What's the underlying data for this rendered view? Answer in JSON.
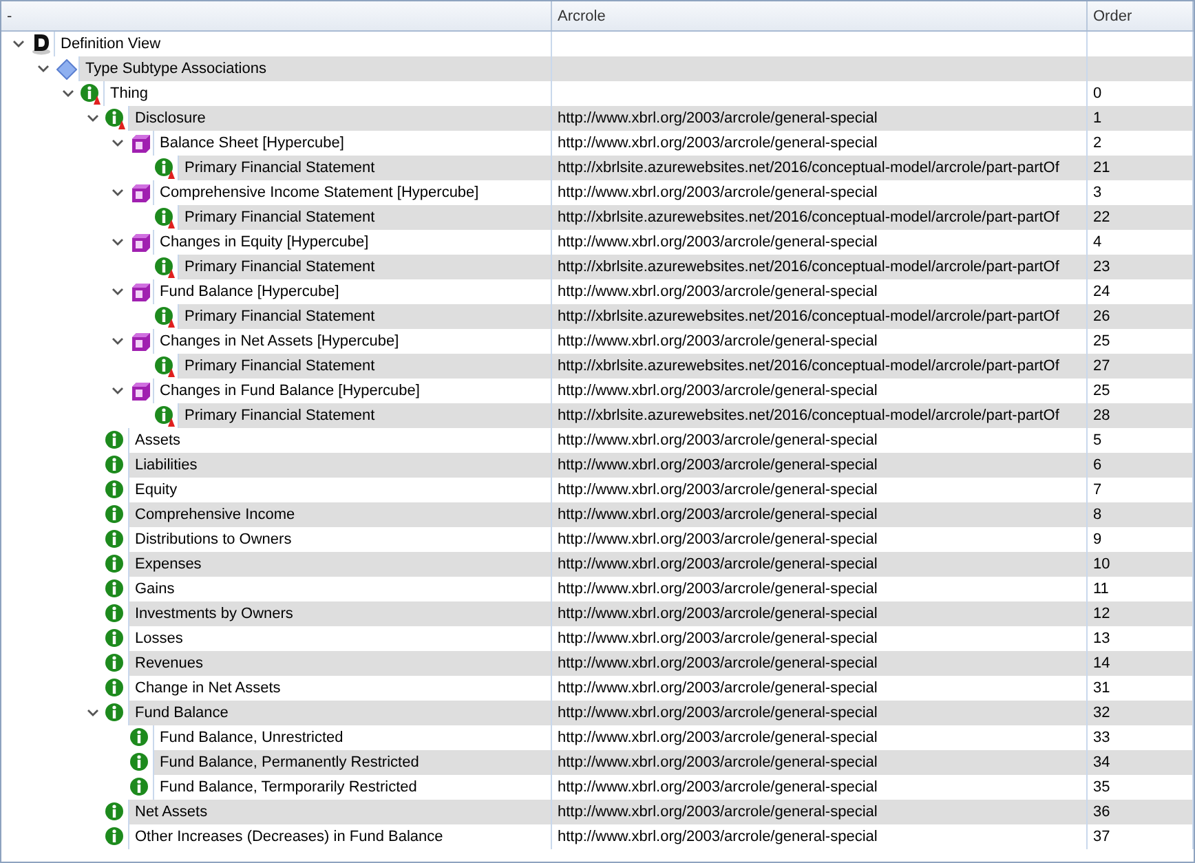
{
  "columns": [
    "-",
    "Arcrole",
    "Order"
  ],
  "tree": [
    {
      "kind": "definition",
      "label": "Definition View",
      "expanded": true,
      "children": [
        {
          "kind": "network",
          "label": "Type Subtype Associations",
          "expanded": true,
          "children": [
            {
              "kind": "abstract",
              "label": "Thing",
              "order": "0",
              "expanded": true,
              "children": [
                {
                  "kind": "abstract",
                  "label": "Disclosure",
                  "arcrole": "http://www.xbrl.org/2003/arcrole/general-special",
                  "order": "1",
                  "expanded": true,
                  "children": [
                    {
                      "kind": "hypercube",
                      "label": "Balance Sheet [Hypercube]",
                      "arcrole": "http://www.xbrl.org/2003/arcrole/general-special",
                      "order": "2",
                      "expanded": true,
                      "children": [
                        {
                          "kind": "abstract",
                          "label": "Primary Financial Statement",
                          "arcrole": "http://xbrlsite.azurewebsites.net/2016/conceptual-model/arcrole/part-partOf",
                          "order": "21"
                        }
                      ]
                    },
                    {
                      "kind": "hypercube",
                      "label": "Comprehensive Income Statement [Hypercube]",
                      "arcrole": "http://www.xbrl.org/2003/arcrole/general-special",
                      "order": "3",
                      "expanded": true,
                      "children": [
                        {
                          "kind": "abstract",
                          "label": "Primary Financial Statement",
                          "arcrole": "http://xbrlsite.azurewebsites.net/2016/conceptual-model/arcrole/part-partOf",
                          "order": "22"
                        }
                      ]
                    },
                    {
                      "kind": "hypercube",
                      "label": "Changes in Equity [Hypercube]",
                      "arcrole": "http://www.xbrl.org/2003/arcrole/general-special",
                      "order": "4",
                      "expanded": true,
                      "children": [
                        {
                          "kind": "abstract",
                          "label": "Primary Financial Statement",
                          "arcrole": "http://xbrlsite.azurewebsites.net/2016/conceptual-model/arcrole/part-partOf",
                          "order": "23"
                        }
                      ]
                    },
                    {
                      "kind": "hypercube",
                      "label": "Fund Balance [Hypercube]",
                      "arcrole": "http://www.xbrl.org/2003/arcrole/general-special",
                      "order": "24",
                      "expanded": true,
                      "children": [
                        {
                          "kind": "abstract",
                          "label": "Primary Financial Statement",
                          "arcrole": "http://xbrlsite.azurewebsites.net/2016/conceptual-model/arcrole/part-partOf",
                          "order": "26"
                        }
                      ]
                    },
                    {
                      "kind": "hypercube",
                      "label": "Changes in Net Assets [Hypercube]",
                      "arcrole": "http://www.xbrl.org/2003/arcrole/general-special",
                      "order": "25",
                      "expanded": true,
                      "children": [
                        {
                          "kind": "abstract",
                          "label": "Primary Financial Statement",
                          "arcrole": "http://xbrlsite.azurewebsites.net/2016/conceptual-model/arcrole/part-partOf",
                          "order": "27"
                        }
                      ]
                    },
                    {
                      "kind": "hypercube",
                      "label": "Changes in Fund Balance [Hypercube]",
                      "arcrole": "http://www.xbrl.org/2003/arcrole/general-special",
                      "order": "25",
                      "expanded": true,
                      "children": [
                        {
                          "kind": "abstract",
                          "label": "Primary Financial Statement",
                          "arcrole": "http://xbrlsite.azurewebsites.net/2016/conceptual-model/arcrole/part-partOf",
                          "order": "28"
                        }
                      ]
                    }
                  ]
                },
                {
                  "kind": "concept",
                  "label": "Assets",
                  "arcrole": "http://www.xbrl.org/2003/arcrole/general-special",
                  "order": "5"
                },
                {
                  "kind": "concept",
                  "label": "Liabilities",
                  "arcrole": "http://www.xbrl.org/2003/arcrole/general-special",
                  "order": "6"
                },
                {
                  "kind": "concept",
                  "label": "Equity",
                  "arcrole": "http://www.xbrl.org/2003/arcrole/general-special",
                  "order": "7"
                },
                {
                  "kind": "concept",
                  "label": "Comprehensive Income",
                  "arcrole": "http://www.xbrl.org/2003/arcrole/general-special",
                  "order": "8"
                },
                {
                  "kind": "concept",
                  "label": "Distributions to Owners",
                  "arcrole": "http://www.xbrl.org/2003/arcrole/general-special",
                  "order": "9"
                },
                {
                  "kind": "concept",
                  "label": "Expenses",
                  "arcrole": "http://www.xbrl.org/2003/arcrole/general-special",
                  "order": "10"
                },
                {
                  "kind": "concept",
                  "label": "Gains",
                  "arcrole": "http://www.xbrl.org/2003/arcrole/general-special",
                  "order": "11"
                },
                {
                  "kind": "concept",
                  "label": "Investments by Owners",
                  "arcrole": "http://www.xbrl.org/2003/arcrole/general-special",
                  "order": "12"
                },
                {
                  "kind": "concept",
                  "label": "Losses",
                  "arcrole": "http://www.xbrl.org/2003/arcrole/general-special",
                  "order": "13"
                },
                {
                  "kind": "concept",
                  "label": "Revenues",
                  "arcrole": "http://www.xbrl.org/2003/arcrole/general-special",
                  "order": "14"
                },
                {
                  "kind": "concept",
                  "label": "Change in Net Assets",
                  "arcrole": "http://www.xbrl.org/2003/arcrole/general-special",
                  "order": "31"
                },
                {
                  "kind": "concept",
                  "label": "Fund Balance",
                  "arcrole": "http://www.xbrl.org/2003/arcrole/general-special",
                  "order": "32",
                  "expanded": true,
                  "children": [
                    {
                      "kind": "concept",
                      "label": "Fund Balance, Unrestricted",
                      "arcrole": "http://www.xbrl.org/2003/arcrole/general-special",
                      "order": "33"
                    },
                    {
                      "kind": "concept",
                      "label": "Fund Balance, Permanently Restricted",
                      "arcrole": "http://www.xbrl.org/2003/arcrole/general-special",
                      "order": "34"
                    },
                    {
                      "kind": "concept",
                      "label": "Fund Balance, Termporarily Restricted",
                      "arcrole": "http://www.xbrl.org/2003/arcrole/general-special",
                      "order": "35"
                    }
                  ]
                },
                {
                  "kind": "concept",
                  "label": "Net Assets",
                  "arcrole": "http://www.xbrl.org/2003/arcrole/general-special",
                  "order": "36"
                },
                {
                  "kind": "concept",
                  "label": "Other Increases (Decreases) in Fund Balance",
                  "arcrole": "http://www.xbrl.org/2003/arcrole/general-special",
                  "order": "37"
                }
              ]
            }
          ]
        }
      ]
    }
  ]
}
